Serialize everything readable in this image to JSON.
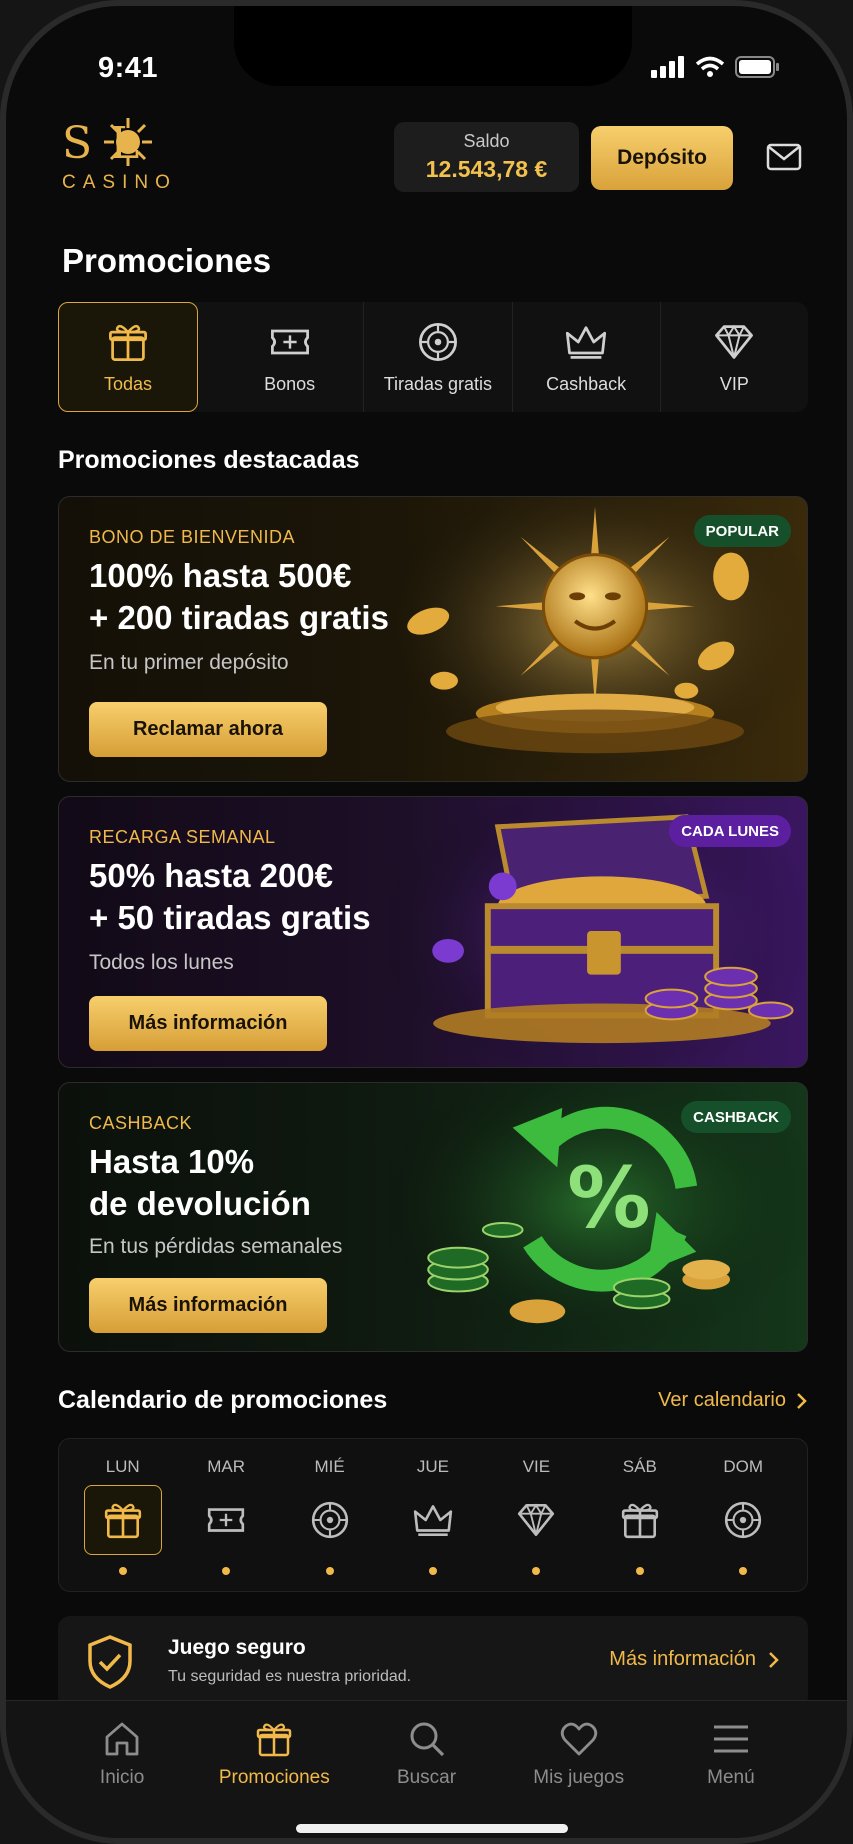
{
  "status": {
    "time": "9:41"
  },
  "header": {
    "logo_top": "S   L",
    "logo_bottom": "CASINO",
    "balance_label": "Saldo",
    "balance_value": "12.543,78 €",
    "deposit_label": "Depósito"
  },
  "page_title": "Promociones",
  "categories": [
    {
      "label": "Todas",
      "icon": "gift-icon",
      "active": true
    },
    {
      "label": "Bonos",
      "icon": "ticket-icon",
      "active": false
    },
    {
      "label": "Tiradas gratis",
      "icon": "chip-icon",
      "active": false
    },
    {
      "label": "Cashback",
      "icon": "crown-icon",
      "active": false
    },
    {
      "label": "VIP",
      "icon": "diamond-icon",
      "active": false
    }
  ],
  "featured_title": "Promociones destacadas",
  "promos": [
    {
      "kicker": "BONO DE BIENVENIDA",
      "title": "100% hasta 500€\n+ 200 tiradas gratis",
      "subtitle": "En tu primer depósito",
      "button": "Reclamar ahora",
      "badge": "POPULAR",
      "badge_color": "#16502a"
    },
    {
      "kicker": "RECARGA SEMANAL",
      "title": "50% hasta 200€\n+ 50 tiradas gratis",
      "subtitle": "Todos los lunes",
      "button": "Más información",
      "badge": "CADA LUNES",
      "badge_color": "#5b1fa0"
    },
    {
      "kicker": "CASHBACK",
      "title": "Hasta 10%\nde devolución",
      "subtitle": "En tus pérdidas semanales",
      "button": "Más información",
      "badge": "CASHBACK",
      "badge_color": "#16502a"
    }
  ],
  "calendar": {
    "title": "Calendario de promociones",
    "link": "Ver calendario",
    "days": [
      {
        "label": "LUN",
        "icon": "gift-icon",
        "active": true
      },
      {
        "label": "MAR",
        "icon": "ticket-icon",
        "active": false
      },
      {
        "label": "MIÉ",
        "icon": "chip-icon",
        "active": false
      },
      {
        "label": "JUE",
        "icon": "crown-icon",
        "active": false
      },
      {
        "label": "VIE",
        "icon": "diamond-icon",
        "active": false
      },
      {
        "label": "SÁB",
        "icon": "gift-icon",
        "active": false
      },
      {
        "label": "DOM",
        "icon": "chip-icon",
        "active": false
      }
    ]
  },
  "safe": {
    "title": "Juego seguro",
    "subtitle": "Tu seguridad es nuestra prioridad.",
    "link": "Más información"
  },
  "tabs": [
    {
      "label": "Inicio",
      "icon": "home-icon",
      "active": false
    },
    {
      "label": "Promociones",
      "icon": "gift-icon",
      "active": true
    },
    {
      "label": "Buscar",
      "icon": "search-icon",
      "active": false
    },
    {
      "label": "Mis juegos",
      "icon": "heart-icon",
      "active": false
    },
    {
      "label": "Menú",
      "icon": "menu-icon",
      "active": false
    }
  ],
  "colors": {
    "accent": "#f0b94a",
    "background": "#0a0a0a"
  }
}
